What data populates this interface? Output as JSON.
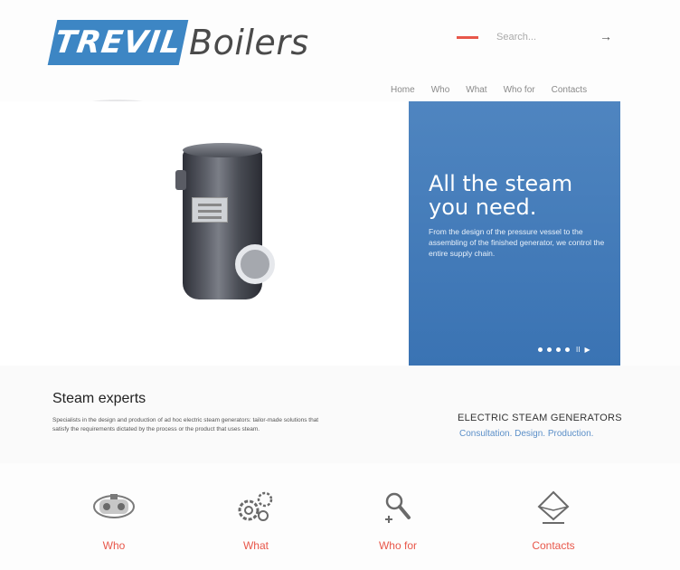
{
  "header": {
    "logo_mark": "TREVIL",
    "logo_text": "Boilers",
    "search_placeholder": "Search...",
    "search_submit_icon": "arrow-right-icon"
  },
  "nav": {
    "items": [
      "Home",
      "Who",
      "What",
      "Who for",
      "Contacts"
    ]
  },
  "hero": {
    "headline_line1": "All the steam",
    "headline_line2": "you need.",
    "subtext": "From the design of the pressure vessel to the assembling of the finished generator, we control the entire supply chain.",
    "slide_count": 4,
    "pause_symbol": "II",
    "play_symbol": "▶",
    "panel_color": "#4a80bd"
  },
  "info": {
    "title": "Steam experts",
    "text": "Specialists in the design and production of ad hoc electric steam generators: tailor-made solutions that satisfy the requirements dictated by the process or the product that uses steam.",
    "product_label": "ELECTRIC STEAM GENERATORS",
    "product_tagline": "Consultation. Design. Production."
  },
  "features": [
    {
      "icon": "boiler-icon",
      "label": "Who"
    },
    {
      "icon": "gears-icon",
      "label": "What"
    },
    {
      "icon": "magnifier-icon",
      "label": "Who for"
    },
    {
      "icon": "envelope-icon",
      "label": "Contacts"
    }
  ],
  "colors": {
    "accent": "#e8574a",
    "brand_blue": "#3d86c4",
    "link_blue": "#5b8fc8"
  }
}
